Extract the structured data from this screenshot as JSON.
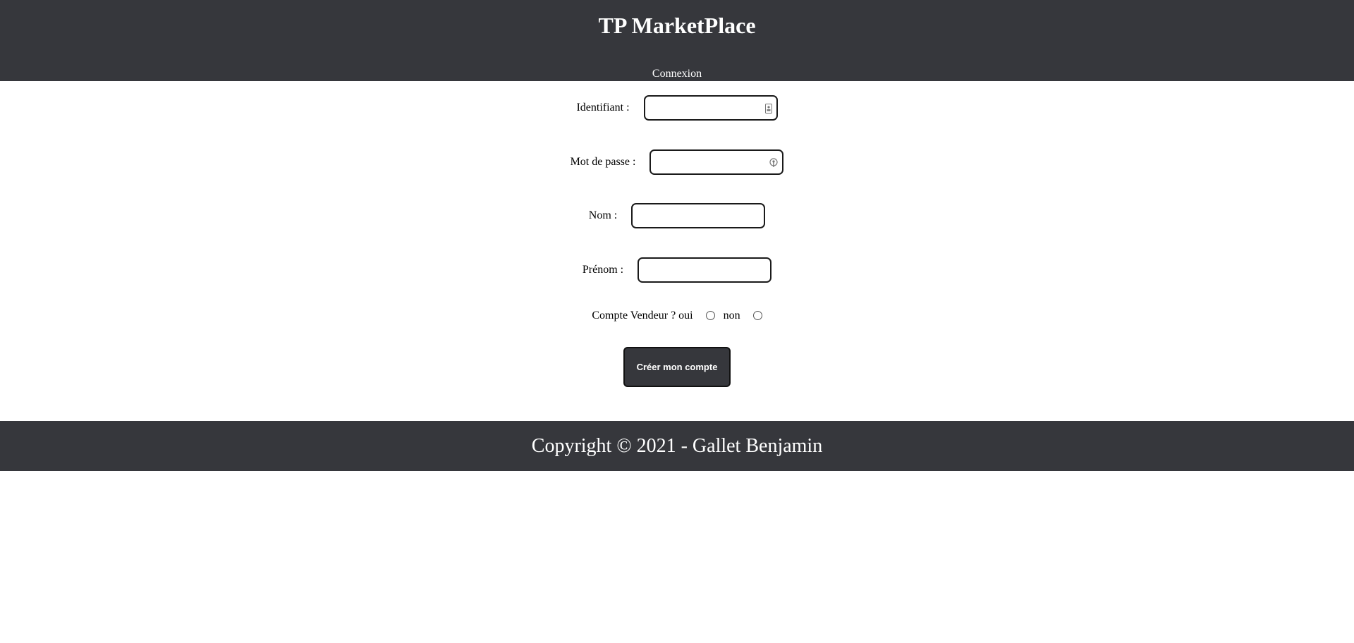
{
  "header": {
    "title": "TP MarketPlace",
    "nav_link": "Connexion"
  },
  "form": {
    "identifiant_label": "Identifiant :",
    "identifiant_value": "",
    "password_label": "Mot de passe :",
    "password_value": "",
    "nom_label": "Nom :",
    "nom_value": "",
    "prenom_label": "Prénom :",
    "prenom_value": "",
    "vendeur_label": "Compte Vendeur ? oui",
    "non_label": "non",
    "submit_label": "Créer mon compte"
  },
  "footer": {
    "text": "Copyright © 2021 - Gallet Benjamin"
  },
  "colors": {
    "bar_background": "#36373c",
    "bar_text": "#ffffff"
  },
  "icons": {
    "identifiant_field": "contact-card-icon",
    "password_field": "password-key-icon"
  }
}
